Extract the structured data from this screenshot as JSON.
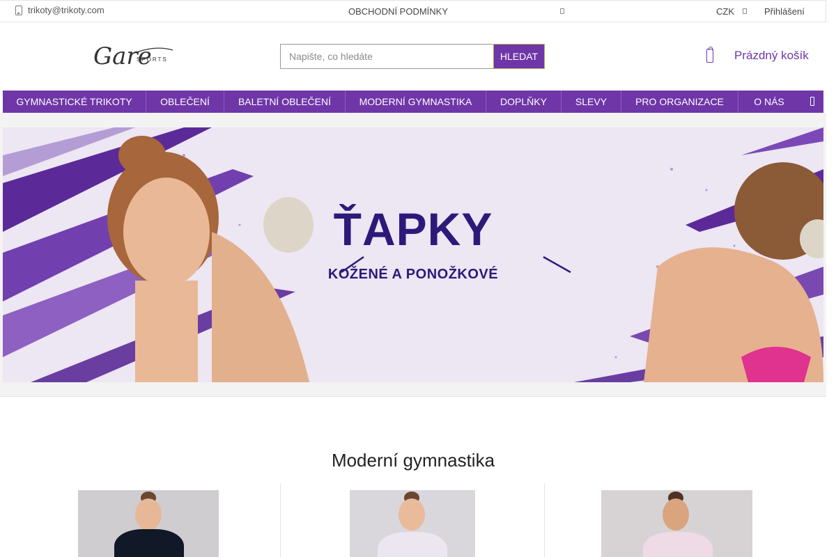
{
  "topbar": {
    "email": "trikoty@trikoty.com",
    "terms": "OBCHODNÍ PODMÍNKY",
    "currency": "CZK",
    "login": "Přihlášení"
  },
  "header": {
    "logo_text": "Gare",
    "logo_sub": "SPORTS",
    "search_placeholder": "Napište, co hledáte",
    "search_button": "HLEDAT",
    "cart_label": "Prázdný košík"
  },
  "nav": {
    "items": [
      "GYMNASTICKÉ TRIKOTY",
      "OBLEČENÍ",
      "BALETNÍ OBLEČENÍ",
      "MODERNÍ GYMNASTIKA",
      "DOPLŇKY",
      "SLEVY",
      "PRO ORGANIZACE",
      "O NÁS"
    ]
  },
  "banner": {
    "title": "ŤAPKY",
    "subtitle": "KOŽENÉ A PONOŽKOVÉ"
  },
  "section": {
    "title": "Moderní gymnastika"
  },
  "colors": {
    "accent": "#6f36a8",
    "banner_text": "#2b1a7a"
  },
  "icons": [
    "phone-icon",
    "info-icon",
    "user-icon",
    "cart-icon",
    "nav-more-icon"
  ]
}
